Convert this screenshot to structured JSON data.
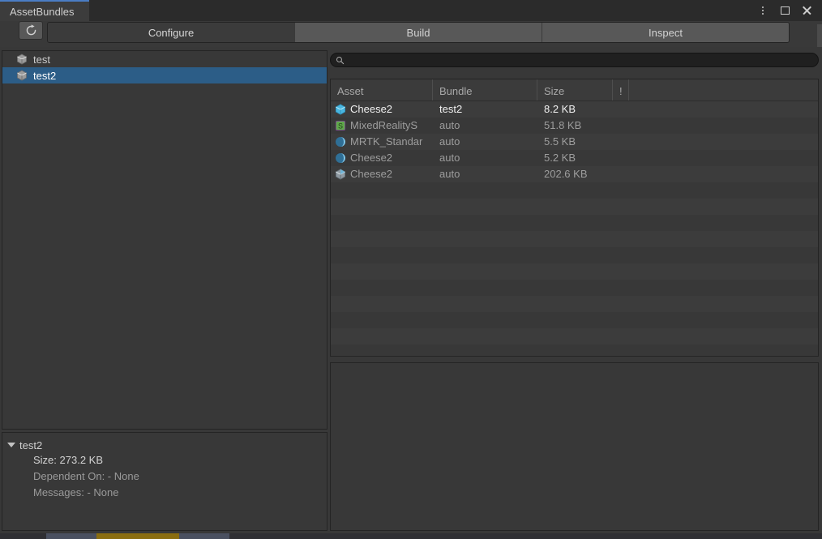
{
  "window": {
    "tab_title": "AssetBundles",
    "controls": [
      {
        "name": "more-menu",
        "icon": "kebab-menu-icon"
      },
      {
        "name": "maximize",
        "icon": "maximize-icon"
      },
      {
        "name": "close",
        "icon": "close-icon"
      }
    ],
    "accent_color": "#4a7dc4"
  },
  "toolbar": {
    "refresh_icon": "refresh-icon",
    "tabs": [
      {
        "label": "Configure",
        "active": true
      },
      {
        "label": "Build",
        "active": false
      },
      {
        "label": "Inspect",
        "active": false
      }
    ]
  },
  "bundle_tree": {
    "items": [
      {
        "label": "test",
        "icon": "bundle-icon",
        "selected": false
      },
      {
        "label": "test2",
        "icon": "bundle-icon",
        "selected": true
      }
    ],
    "selection_color": "#2c5d87"
  },
  "bundle_info": {
    "title": "test2",
    "expanded": true,
    "lines": [
      {
        "text": "Size: 273.2 KB",
        "bright": true
      },
      {
        "text": "Dependent On: - None",
        "bright": false
      },
      {
        "text": "Messages: - None",
        "bright": false
      }
    ]
  },
  "search": {
    "value": "",
    "placeholder": "",
    "icon": "search-icon"
  },
  "asset_table": {
    "columns": [
      {
        "key": "asset",
        "label": "Asset"
      },
      {
        "key": "bundle",
        "label": "Bundle"
      },
      {
        "key": "size",
        "label": "Size"
      },
      {
        "key": "bang",
        "label": "!"
      },
      {
        "key": "rest",
        "label": ""
      }
    ],
    "rows": [
      {
        "asset": "Cheese2",
        "bundle": "test2",
        "size": "8.2 KB",
        "bang": "",
        "icon": "prefab-icon",
        "bright": true
      },
      {
        "asset": "MixedRealityS",
        "bundle": "auto",
        "size": "51.8 KB",
        "bang": "",
        "icon": "shader-icon",
        "bright": false
      },
      {
        "asset": "MRTK_Standar",
        "bundle": "auto",
        "size": "5.5 KB",
        "bang": "",
        "icon": "material-icon",
        "bright": false
      },
      {
        "asset": "Cheese2",
        "bundle": "auto",
        "size": "5.2 KB",
        "bang": "",
        "icon": "material-icon",
        "bright": false
      },
      {
        "asset": "Cheese2",
        "bundle": "auto",
        "size": "202.6 KB",
        "bang": "",
        "icon": "model-icon",
        "bright": false
      }
    ],
    "empty_row_count": 11
  }
}
